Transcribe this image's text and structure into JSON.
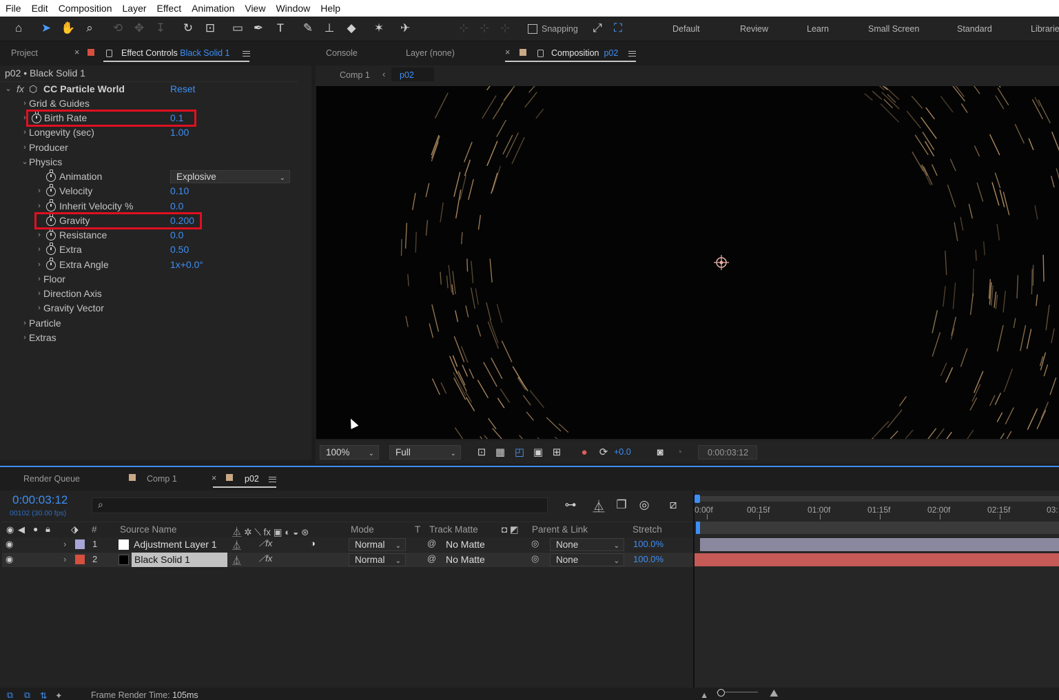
{
  "menu": [
    "File",
    "Edit",
    "Composition",
    "Layer",
    "Effect",
    "Animation",
    "View",
    "Window",
    "Help"
  ],
  "toolbar": {
    "snapping_label": "Snapping",
    "workspaces": [
      "Default",
      "Review",
      "Learn",
      "Small Screen",
      "Standard",
      "Librarie"
    ]
  },
  "left_panel": {
    "tab_project": "Project",
    "tab_effect_prefix": "Effect Controls",
    "tab_effect_layer": "Black Solid 1",
    "header": "p02 • Black Solid 1",
    "effect_name": "CC Particle World",
    "reset_label": "Reset",
    "fx_label": "fx",
    "params": [
      {
        "label": "Grid & Guides",
        "value": ""
      },
      {
        "label": "Birth Rate",
        "value": "0.1"
      },
      {
        "label": "Longevity (sec)",
        "value": "1.00"
      },
      {
        "label": "Producer",
        "value": ""
      },
      {
        "label": "Physics",
        "value": ""
      },
      {
        "label": "Animation",
        "value": "Explosive"
      },
      {
        "label": "Velocity",
        "value": "0.10"
      },
      {
        "label": "Inherit Velocity %",
        "value": "0.0"
      },
      {
        "label": "Gravity",
        "value": "0.200"
      },
      {
        "label": "Resistance",
        "value": "0.0"
      },
      {
        "label": "Extra",
        "value": "0.50"
      },
      {
        "label": "Extra Angle",
        "value": "1x+0.0°"
      },
      {
        "label": "Floor",
        "value": ""
      },
      {
        "label": "Direction Axis",
        "value": ""
      },
      {
        "label": "Gravity Vector",
        "value": ""
      },
      {
        "label": "Particle",
        "value": ""
      },
      {
        "label": "Extras",
        "value": ""
      }
    ]
  },
  "viewer": {
    "tab_console": "Console",
    "tab_layer": "Layer (none)",
    "tab_comp_prefix": "Composition",
    "tab_comp_name": "p02",
    "crumb_comp1": "Comp 1",
    "crumb_current": "p02",
    "zoom": "100%",
    "resolution": "Full",
    "exposure": "+0.0",
    "timecode": "0:00:03:12"
  },
  "timeline": {
    "tab_render_queue": "Render Queue",
    "tab_comp1": "Comp 1",
    "tab_p02": "p02",
    "timecode": "0:00:03:12",
    "frame_info": "00102 (30.00 fps)",
    "columns": {
      "num": "#",
      "source": "Source Name",
      "mode": "Mode",
      "t": "T",
      "track_matte": "Track Matte",
      "parent": "Parent & Link",
      "stretch": "Stretch"
    },
    "layers": [
      {
        "num": "1",
        "name": "Adjustment Layer 1",
        "mode": "Normal",
        "matte": "No Matte",
        "parent": "None",
        "stretch": "100.0%",
        "label_color": "#a8a6d6",
        "swatch": "#ffffff"
      },
      {
        "num": "2",
        "name": "Black Solid 1",
        "mode": "Normal",
        "matte": "No Matte",
        "parent": "None",
        "stretch": "100.0%",
        "label_color": "#d5503f",
        "swatch": "#000000"
      }
    ],
    "ruler": [
      "0:00f",
      "00:15f",
      "01:00f",
      "01:15f",
      "02:00f",
      "02:15f",
      "03:"
    ],
    "frame_render_label": "Frame Render Time:",
    "frame_render_value": "105ms"
  },
  "colors": {
    "accent": "#3d8ff5",
    "highlight_box": "#e01020",
    "solid_bar": "#c55a57",
    "adjust_bar": "#8a889f"
  }
}
